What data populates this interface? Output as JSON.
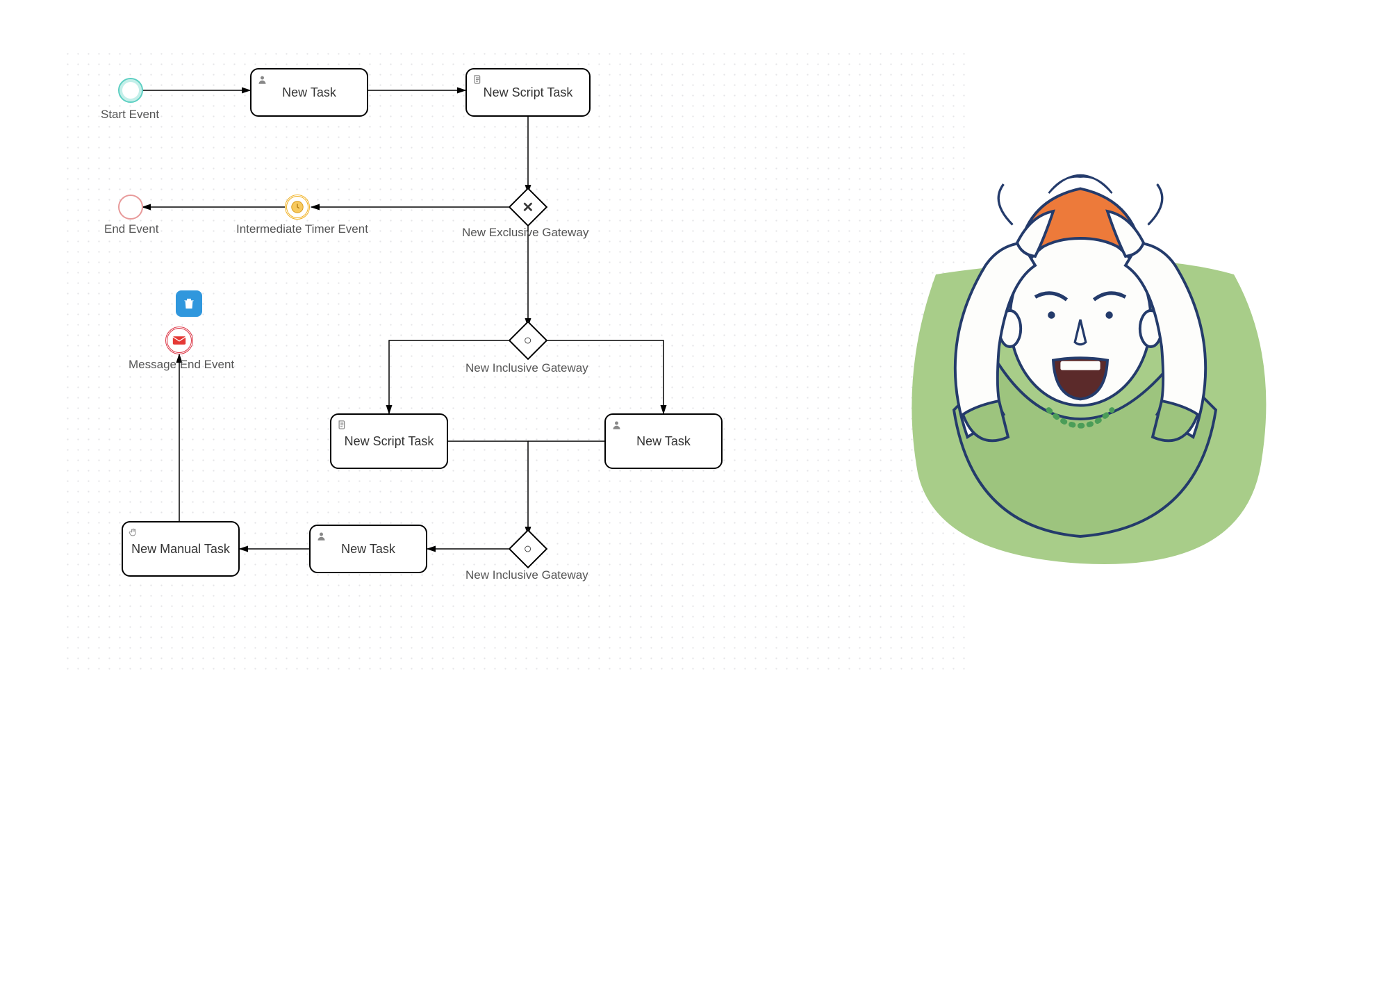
{
  "events": {
    "start": {
      "label": "Start Event"
    },
    "end": {
      "label": "End Event"
    },
    "timer": {
      "label": "Intermediate Timer Event"
    },
    "msg_end": {
      "label": "Message End Event"
    }
  },
  "tasks": {
    "t1": {
      "label": "New Task",
      "type": "user"
    },
    "t2": {
      "label": "New Script Task",
      "type": "script"
    },
    "t3": {
      "label": "New Script Task",
      "type": "script"
    },
    "t4": {
      "label": "New Task",
      "type": "user"
    },
    "t5": {
      "label": "New Task",
      "type": "user"
    },
    "t6": {
      "label": "New Manual Task",
      "type": "manual"
    }
  },
  "gateways": {
    "g1": {
      "label": "New Exclusive Gateway",
      "type": "exclusive"
    },
    "g2": {
      "label": "New Inclusive Gateway",
      "type": "inclusive"
    },
    "g3": {
      "label": "New Inclusive Gateway",
      "type": "inclusive"
    }
  },
  "toolbar": {
    "delete": "Delete"
  }
}
